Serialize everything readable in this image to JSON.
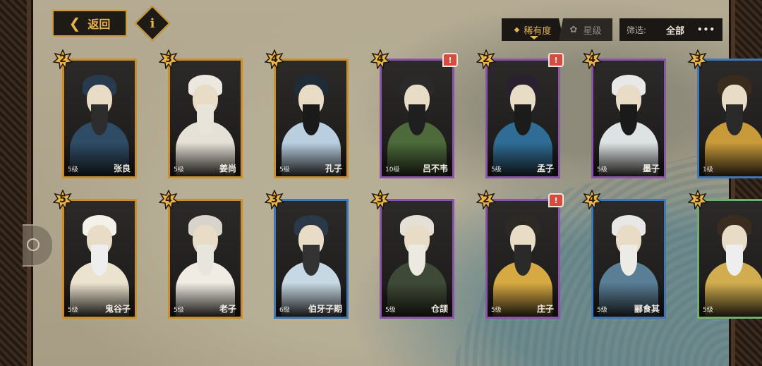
{
  "header": {
    "back_label": "返回",
    "info_label": "i",
    "sort_rarity_label": "稀有度",
    "sort_star_label": "星级",
    "filter_label": "筛选:",
    "filter_value": "全部",
    "more_label": "•••"
  },
  "cards_row1": [
    {
      "name": "张良",
      "level": "5级",
      "stars": "2",
      "rarity": "gold",
      "alert": "",
      "robe": "#2e4c66",
      "hair": "#283a4d",
      "beard": "#2d2d2d"
    },
    {
      "name": "姜尚",
      "level": "5级",
      "stars": "3",
      "rarity": "gold",
      "alert": "",
      "robe": "#e6e1d6",
      "hair": "#ece8e0",
      "beard": "#e9e4da"
    },
    {
      "name": "孔子",
      "level": "5级",
      "stars": "4",
      "rarity": "gold",
      "alert": "",
      "robe": "#b9cfe0",
      "hair": "#1f2b36",
      "beard": "#1a1a1a"
    },
    {
      "name": "吕不韦",
      "level": "10级",
      "stars": "4",
      "rarity": "purple",
      "alert": "!",
      "robe": "#4c6a3a",
      "hair": "#2a2a2a",
      "beard": "#1f1f1f"
    },
    {
      "name": "孟子",
      "level": "5级",
      "stars": "2",
      "rarity": "purple",
      "alert": "!",
      "robe": "#2f6d96",
      "hair": "#2a2130",
      "beard": "#1b1b1b"
    },
    {
      "name": "墨子",
      "level": "5级",
      "stars": "4",
      "rarity": "purple",
      "alert": "",
      "robe": "#dde3e3",
      "hair": "#e8e8e8",
      "beard": "#1a1a1a"
    },
    {
      "name": "",
      "level": "1级",
      "stars": "3",
      "rarity": "blue",
      "alert": "",
      "robe": "#c99a3a",
      "hair": "#3b2b1c",
      "beard": "#2a2a2a"
    }
  ],
  "cards_row2": [
    {
      "name": "鬼谷子",
      "level": "5级",
      "stars": "5",
      "rarity": "gold",
      "alert": "",
      "robe": "#ece3cf",
      "hair": "#f4f1ea",
      "beard": "#eee"
    },
    {
      "name": "老子",
      "level": "5级",
      "stars": "4",
      "rarity": "gold",
      "alert": "",
      "robe": "#f0ece4",
      "hair": "#d8d4cc",
      "beard": "#e8e5df"
    },
    {
      "name": "伯牙子期",
      "level": "6级",
      "stars": "3",
      "rarity": "blue",
      "alert": "",
      "robe": "#c6d8e4",
      "hair": "#2b3847",
      "beard": "#333"
    },
    {
      "name": "仓颉",
      "level": "5级",
      "stars": "3",
      "rarity": "purple",
      "alert": "",
      "robe": "#3e4a36",
      "hair": "#e4e0d6",
      "beard": "#ece9e1"
    },
    {
      "name": "庄子",
      "level": "5级",
      "stars": "2",
      "rarity": "purple",
      "alert": "!",
      "robe": "#d6a942",
      "hair": "#2d2a26",
      "beard": "#2a2a2a"
    },
    {
      "name": "郦食其",
      "level": "5级",
      "stars": "4",
      "rarity": "blue",
      "alert": "",
      "robe": "#5a7e96",
      "hair": "#e7e7e7",
      "beard": "#ecebe6"
    },
    {
      "name": "",
      "level": "5级",
      "stars": "3",
      "rarity": "green",
      "alert": "",
      "robe": "#d1ad4f",
      "hair": "#3a2d20",
      "beard": "#eee"
    }
  ],
  "colors": {
    "gold": "#c98f2c",
    "purple": "#8a55a8",
    "blue": "#3e78b6",
    "green": "#6fae6e",
    "accent": "#e4b456"
  }
}
